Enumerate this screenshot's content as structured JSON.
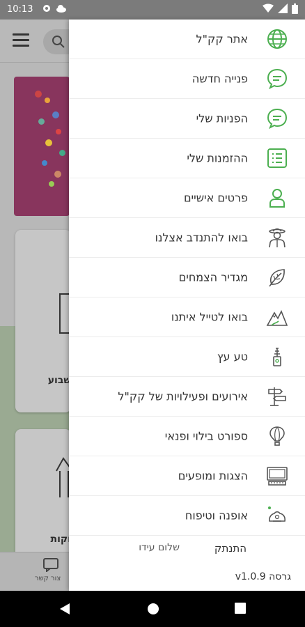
{
  "status_bar": {
    "time": "10:13"
  },
  "drawer": {
    "items": [
      {
        "label": "אתר קק\"ל",
        "icon": "globe-icon"
      },
      {
        "label": "פנייה חדשה",
        "icon": "chat-bubble-icon"
      },
      {
        "label": "הפניות שלי",
        "icon": "chat-bubble-icon"
      },
      {
        "label": "ההזמנות שלי",
        "icon": "list-icon"
      },
      {
        "label": "פרטים אישיים",
        "icon": "person-icon"
      },
      {
        "label": "בואו להתנדב אצלנו",
        "icon": "volunteer-icon"
      },
      {
        "label": "מגדיר הצמחים",
        "icon": "leaf-icon"
      },
      {
        "label": "בואו לטייל איתנו",
        "icon": "mountains-icon"
      },
      {
        "label": "טע עץ",
        "icon": "tree-icon"
      },
      {
        "label": "אירועים ופעילויות של קק\"ל",
        "icon": "signpost-icon"
      },
      {
        "label": "ספורט בילוי ופנאי",
        "icon": "hot-air-balloon-icon"
      },
      {
        "label": "הצגות ומופעים",
        "icon": "monitor-icon"
      },
      {
        "label": "אופנה וטיפוח",
        "icon": "fashion-icon"
      }
    ],
    "logout_label": "התנתק",
    "greeting": "שלום עידו",
    "version": "גרסה v1.0.9"
  },
  "background": {
    "card1_text": "שבוע",
    "card2_text": "וקות",
    "bottom_nav_label": "צור קשר"
  },
  "colors": {
    "accent": "#4caf50",
    "icon_gray": "#555555"
  }
}
